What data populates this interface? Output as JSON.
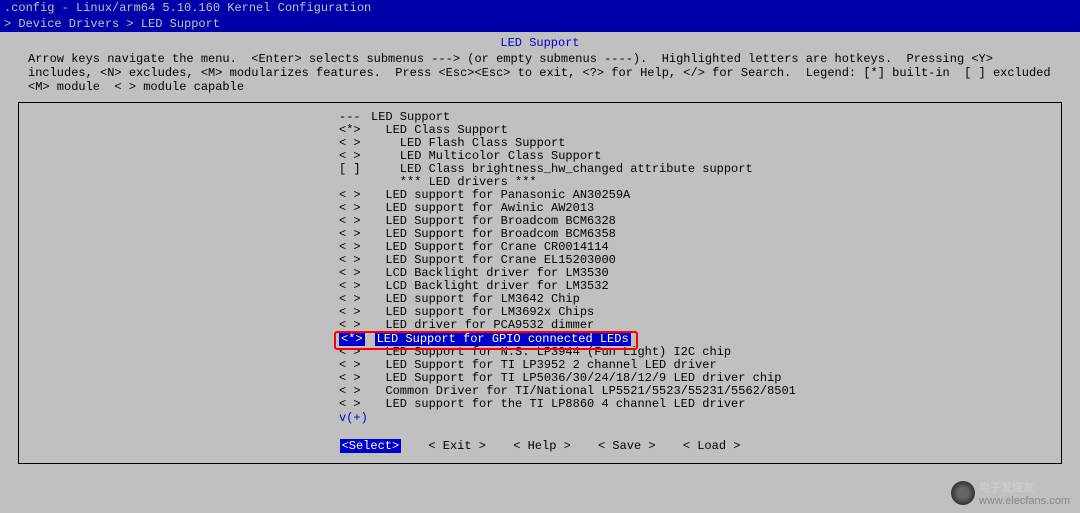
{
  "titlebar": ".config - Linux/arm64 5.10.160 Kernel Configuration",
  "breadcrumb": "> Device Drivers > LED Support",
  "page_title": "LED Support",
  "help_text": "Arrow keys navigate the menu.  <Enter> selects submenus ---> (or empty submenus ----).  Highlighted letters are hotkeys.  Pressing <Y> includes, <N> excludes, <M> modularizes features.  Press <Esc><Esc> to exit, <?> for Help, </> for Search.  Legend: [*] built-in  [ ] excluded  <M> module  < > module capable",
  "menu": {
    "items": [
      {
        "mark": "---",
        "label": "LED Support"
      },
      {
        "mark": "<*>",
        "label": "  LED Class Support"
      },
      {
        "mark": "< >",
        "label": "    LED Flash Class Support"
      },
      {
        "mark": "< >",
        "label": "    LED Multicolor Class Support"
      },
      {
        "mark": "[ ]",
        "label": "    LED Class brightness_hw_changed attribute support"
      },
      {
        "mark": "   ",
        "label": "    *** LED drivers ***"
      },
      {
        "mark": "< >",
        "label": "  LED support for Panasonic AN30259A"
      },
      {
        "mark": "< >",
        "label": "  LED support for Awinic AW2013"
      },
      {
        "mark": "< >",
        "label": "  LED Support for Broadcom BCM6328"
      },
      {
        "mark": "< >",
        "label": "  LED Support for Broadcom BCM6358"
      },
      {
        "mark": "< >",
        "label": "  LED Support for Crane CR0014114"
      },
      {
        "mark": "< >",
        "label": "  LED Support for Crane EL15203000"
      },
      {
        "mark": "< >",
        "label": "  LCD Backlight driver for LM3530"
      },
      {
        "mark": "< >",
        "label": "  LCD Backlight driver for LM3532"
      },
      {
        "mark": "< >",
        "label": "  LED support for LM3642 Chip"
      },
      {
        "mark": "< >",
        "label": "  LED support for LM3692x Chips"
      },
      {
        "mark": "< >",
        "label": "  LED driver for PCA9532 dimmer"
      },
      {
        "mark": "<*>",
        "label": "  LED Support for GPIO connected LEDs",
        "selected": true
      },
      {
        "mark": "< >",
        "label": "  LED Support for N.S. LP3944 (Fun Light) I2C chip"
      },
      {
        "mark": "< >",
        "label": "  LED Support for TI LP3952 2 channel LED driver"
      },
      {
        "mark": "< >",
        "label": "  LED Support for TI LP5036/30/24/18/12/9 LED driver chip"
      },
      {
        "mark": "< >",
        "label": "  Common Driver for TI/National LP5521/5523/55231/5562/8501"
      },
      {
        "mark": "< >",
        "label": "  LED support for the TI LP8860 4 channel LED driver"
      }
    ],
    "scroll_indicator": "v(+)"
  },
  "buttons": {
    "select": "<Select>",
    "exit": "< Exit >",
    "help": "< Help >",
    "save": "< Save >",
    "load": "< Load >"
  },
  "watermark": {
    "line1": "电子发烧友",
    "line2": "www.elecfans.com"
  }
}
